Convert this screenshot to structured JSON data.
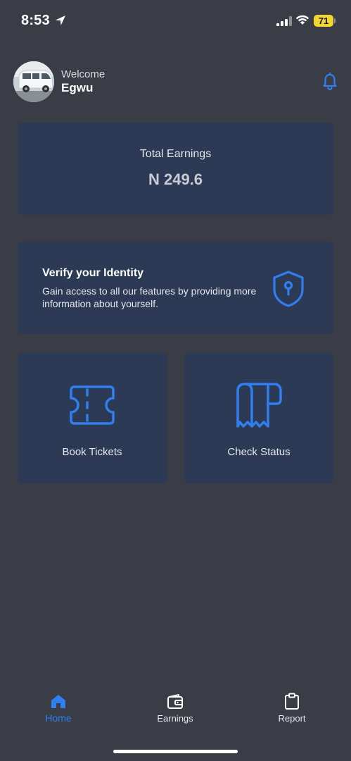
{
  "status_bar": {
    "time": "8:53",
    "battery_level": "71",
    "icons": [
      "location-arrow-icon",
      "cellular-signal-icon",
      "wifi-icon",
      "battery-icon"
    ]
  },
  "header": {
    "welcome_label": "Welcome",
    "user_name": "Egwu",
    "avatar": "van-photo-avatar",
    "notification_icon": "bell-icon"
  },
  "earnings": {
    "title": "Total Earnings",
    "value": "N 249.6"
  },
  "verify": {
    "title": "Verify your Identity",
    "description": "Gain access to all our features by providing more information about yourself.",
    "icon": "shield-keyhole-icon"
  },
  "tiles": [
    {
      "label": "Book Tickets",
      "icon": "ticket-icon"
    },
    {
      "label": "Check Status",
      "icon": "receipt-icon"
    }
  ],
  "bottom_nav": [
    {
      "label": "Home",
      "icon": "home-icon",
      "active": true
    },
    {
      "label": "Earnings",
      "icon": "wallet-icon",
      "active": false
    },
    {
      "label": "Report",
      "icon": "clipboard-icon",
      "active": false
    }
  ],
  "colors": {
    "background": "#3a3d45",
    "card": "#2c3a55",
    "accent": "#2f7ff0",
    "battery": "#f2d72e"
  }
}
